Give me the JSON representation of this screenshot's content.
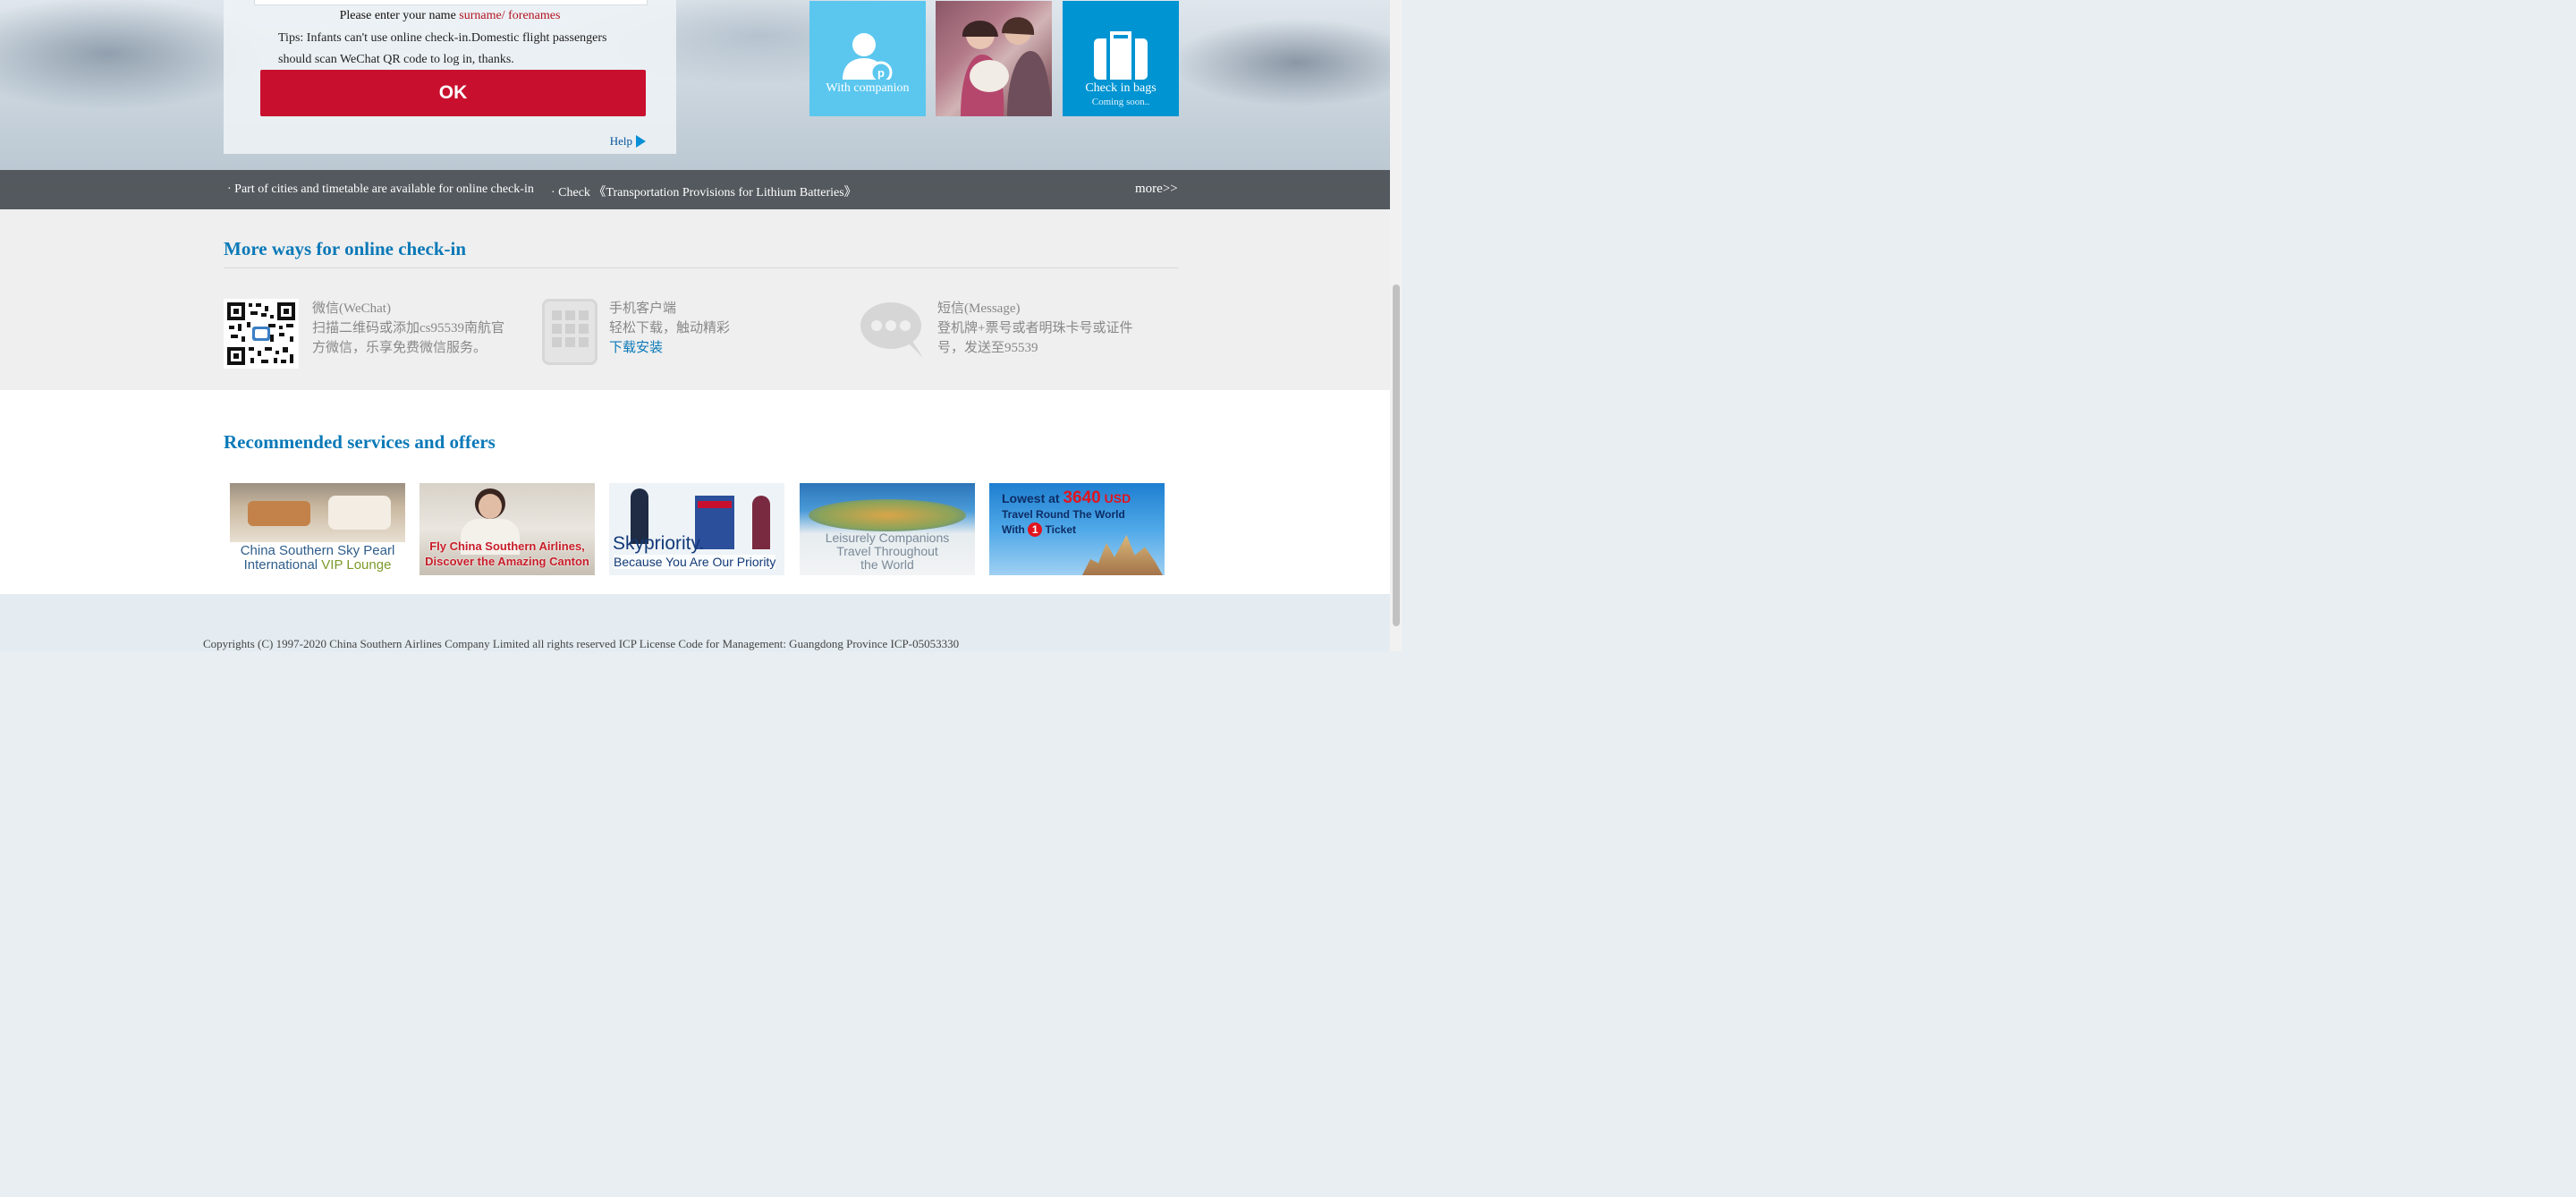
{
  "checkin_form": {
    "name_hint_prefix": "Please enter your name",
    "name_hint_format": "surname/ forenames",
    "tips_line1": "Tips: Infants can't use online check-in.Domestic flight passengers",
    "tips_line2": "should scan WeChat QR code to log in, thanks.",
    "ok_label": "OK",
    "help_label": "Help"
  },
  "tiles": {
    "companion_label": "With companion",
    "bags_label": "Check in bags",
    "bags_sub": "Coming soon.."
  },
  "news": {
    "item1": "· Part of cities and timetable are available for online check-in",
    "item2": "· Check 《Transportation Provisions for Lithium Batteries》",
    "more": "more>>"
  },
  "more_ways": {
    "title": "More ways for online check-in",
    "wechat": {
      "title": "微信(WeChat)",
      "line1": "扫描二维码或添加cs95539南航官",
      "line2": "方微信，乐享免费微信服务。"
    },
    "app": {
      "title": "手机客户端",
      "line1": "轻松下载，触动精彩",
      "link": "下载安装"
    },
    "sms": {
      "title": "短信(Message)",
      "line1": "登机牌+票号或者明珠卡号或证件",
      "line2": "号，发送至95539"
    }
  },
  "recommended": {
    "title": "Recommended services and offers",
    "offers": [
      {
        "line1": "China Southern Sky Pearl",
        "line2_a": "International ",
        "line2_b": "VIP Lounge"
      },
      {
        "line1": "Fly China Southern Airlines,",
        "line2": "Discover the Amazing Canton"
      },
      {
        "line1": "Skypriority.",
        "line2": "Because You Are Our Priority"
      },
      {
        "line1": "Leisurely Companions",
        "line2": "Travel Throughout",
        "line3": "the World"
      },
      {
        "line1_a": "Lowest at ",
        "line1_b": "3640",
        "line1_c": " USD",
        "line2": "Travel Round The World",
        "line3_a": "With ",
        "line3_b": "1",
        "line3_c": " Ticket"
      }
    ]
  },
  "footer": {
    "copyright": "Copyrights (C) 1997-2020 China Southern Airlines Company Limited all rights reserved ICP License Code for Management: Guangdong Province ICP-05053330"
  },
  "colors": {
    "brand_red": "#c8102e",
    "brand_blue": "#0a79b8",
    "tile_light_blue": "#5bc7ef",
    "tile_blue": "#0094d2"
  }
}
